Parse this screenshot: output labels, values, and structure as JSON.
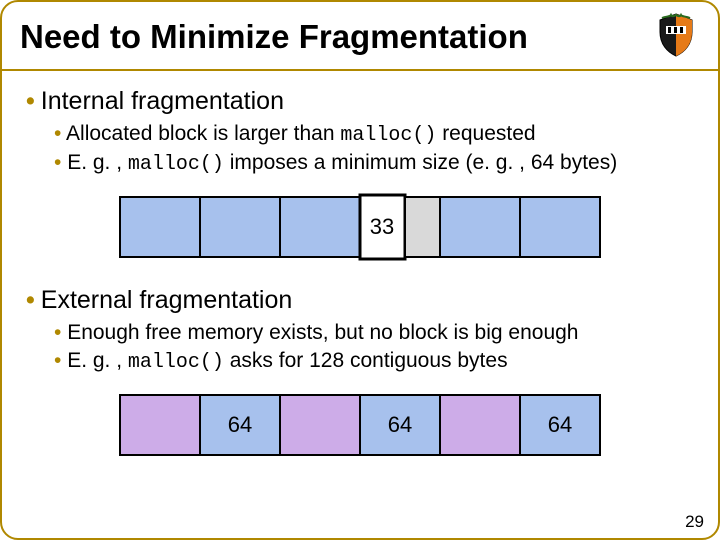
{
  "title": "Need to Minimize Fragmentation",
  "page_number": "29",
  "section1": {
    "heading": "Internal fragmentation",
    "bullet1_a": "Allocated block is larger than ",
    "bullet1_b": " requested",
    "bullet2_a": "E. g. , ",
    "bullet2_b": " imposes a minimum size (e. g. , 64 bytes)",
    "code": "malloc()",
    "cell_label": "33"
  },
  "section2": {
    "heading": "External fragmentation",
    "bullet1": "Enough free memory exists, but no block is big enough",
    "bullet2_a": "E. g. , ",
    "bullet2_b": " asks for 128 contiguous bytes",
    "code": "malloc()",
    "cell_label": "64"
  }
}
